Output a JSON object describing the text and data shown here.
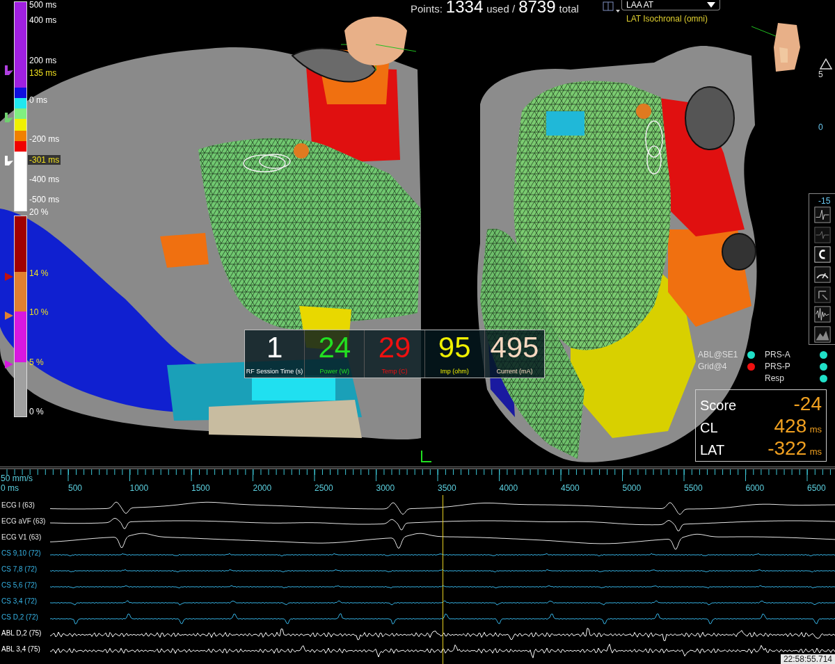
{
  "lat_scale": {
    "segments": [
      {
        "color": "#a020e0"
      },
      {
        "color": "#1010e0"
      },
      {
        "color": "#20e8f0"
      },
      {
        "color": "#80f080"
      },
      {
        "color": "#f0f000"
      },
      {
        "color": "#f08000"
      },
      {
        "color": "#f00000"
      },
      {
        "color": "#ffffff"
      }
    ],
    "labels": [
      {
        "text": "500 ms",
        "kind": "tick"
      },
      {
        "text": "400 ms",
        "kind": "tick"
      },
      {
        "text": "200 ms",
        "kind": "tick"
      },
      {
        "text": "135 ms",
        "kind": "marker"
      },
      {
        "text": "0 ms",
        "kind": "tick"
      },
      {
        "text": "-200 ms",
        "kind": "tick"
      },
      {
        "text": "-301 ms",
        "kind": "cursor"
      },
      {
        "text": "-400 ms",
        "kind": "tick"
      },
      {
        "text": "-500 ms",
        "kind": "tick"
      }
    ],
    "markers": [
      {
        "color": "#b040e0"
      },
      {
        "color": "#70d070"
      },
      {
        "color": "#ffffff"
      }
    ]
  },
  "voltage_scale": {
    "segments": [
      {
        "color": "#a00000"
      },
      {
        "color": "#e08030"
      },
      {
        "color": "#d818e0"
      },
      {
        "color": "#a0a0a0"
      }
    ],
    "labels": [
      {
        "text": "20 %",
        "kind": "tick"
      },
      {
        "text": "14 %",
        "kind": "marker"
      },
      {
        "text": "10 %",
        "kind": "marker"
      },
      {
        "text": "5 %",
        "kind": "marker"
      },
      {
        "text": "0 %",
        "kind": "tick"
      }
    ],
    "markers": [
      {
        "color": "#c01010"
      },
      {
        "color": "#e08030"
      },
      {
        "color": "#d818e0"
      }
    ]
  },
  "points": {
    "label": "Points:",
    "used": "1334",
    "used_label": "used /",
    "total": "8739",
    "total_label": "total"
  },
  "map_selector": {
    "value": "LAA AT",
    "subtitle": "LAT Isochronal (omni)"
  },
  "rf_panel": [
    {
      "value": "1",
      "label": "RF Session Time (s)",
      "color": "#ffffff"
    },
    {
      "value": "24",
      "label": "Power (W)",
      "color": "#22e022"
    },
    {
      "value": "29",
      "label": "Temp (C)",
      "color": "#f01010"
    },
    {
      "value": "95",
      "label": "Imp (ohm)",
      "color": "#f0f000"
    },
    {
      "value": "495",
      "label": "Current (mA)",
      "color": "#f8d8c0"
    }
  ],
  "legend": {
    "left": [
      {
        "label": "ABL@SE1",
        "color": "#20e0c8"
      },
      {
        "label": "Grid@4",
        "color": "#f01010"
      }
    ],
    "right": [
      {
        "label": "PRS-A",
        "color": "#20e0c8"
      },
      {
        "label": "PRS-P",
        "color": "#20e0c8"
      },
      {
        "label": "Resp",
        "color": "#20e0c8"
      }
    ]
  },
  "score_box": [
    {
      "label": "Score",
      "value": "-24"
    },
    {
      "label": "CL",
      "value": "428",
      "unit": "ms"
    },
    {
      "label": "LAT",
      "value": "-322",
      "unit": "ms"
    }
  ],
  "side_readouts": [
    "5",
    "0",
    "-15"
  ],
  "ruler": {
    "speed": "50 mm/s",
    "start": "0 ms",
    "labels": [
      "500",
      "1000",
      "1500",
      "2000",
      "2500",
      "3000",
      "3500",
      "4000",
      "4500",
      "5000",
      "5500",
      "6000",
      "6500"
    ]
  },
  "channels": [
    {
      "label": "ECG I (63)",
      "kind": "ecg"
    },
    {
      "label": "ECG aVF (63)",
      "kind": "ecg"
    },
    {
      "label": "ECG V1 (63)",
      "kind": "ecg"
    },
    {
      "label": "CS 9,10 (72)",
      "kind": "cs"
    },
    {
      "label": "CS 7,8 (72)",
      "kind": "cs"
    },
    {
      "label": "CS 5,6 (72)",
      "kind": "cs"
    },
    {
      "label": "CS 3,4 (72)",
      "kind": "cs"
    },
    {
      "label": "CS D,2 (72)",
      "kind": "cs"
    },
    {
      "label": "ABL D,2 (75)",
      "kind": "abl"
    },
    {
      "label": "ABL 3,4 (75)",
      "kind": "abl"
    }
  ],
  "timestamp": "22:58:55.714"
}
